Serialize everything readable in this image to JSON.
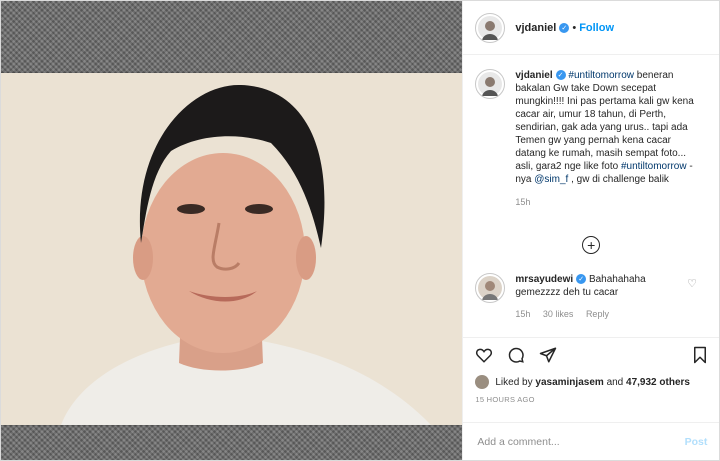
{
  "header": {
    "username": "vjdaniel",
    "separator": "•",
    "follow_label": "Follow"
  },
  "caption": {
    "username": "vjdaniel",
    "hashtag1": "#untiltomorrow",
    "text1": " beneran bakalan Gw take Down secepat mungkin!!!! Ini pas pertama kali gw kena cacar air, umur 18 tahun, di Perth, sendirian, gak ada yang urus.. tapi ada Temen gw yang pernah kena cacar datang ke rumah, masih sempat foto... asli, gara2 nge like foto ",
    "hashtag2": "#untiltomorrow",
    "text2": " -nya ",
    "mention": "@sim_f",
    "text3": " , gw di challenge balik",
    "time": "15h"
  },
  "load_more_icon": "plus-circle-icon",
  "comment": {
    "username": "mrsayudewi",
    "text": "Bahahahaha gemezzzz deh tu cacar",
    "time": "15h",
    "likes": "30 likes",
    "reply": "Reply"
  },
  "actions": {
    "icons": [
      "heart-icon",
      "comment-icon",
      "share-icon",
      "bookmark-icon"
    ]
  },
  "likes": {
    "prefix": "Liked by ",
    "user": "yasaminjasem",
    "middle": " and ",
    "count": "47,932 others"
  },
  "timestamp": "15 HOURS AGO",
  "add_comment": {
    "placeholder": "Add a comment...",
    "post_label": "Post"
  },
  "colors": {
    "accent": "#0095f6",
    "verified": "#3897f0",
    "hashtag": "#00376b"
  }
}
